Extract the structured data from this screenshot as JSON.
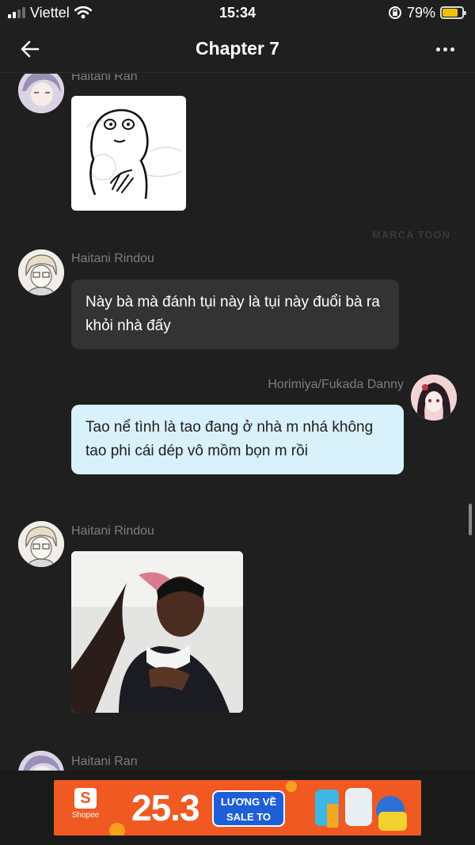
{
  "status": {
    "carrier": "Viettel",
    "time": "15:34",
    "battery_percent": "79%",
    "battery_level": 0.79
  },
  "header": {
    "title": "Chapter 7"
  },
  "messages": [
    {
      "sender": "Haitani Ran",
      "type": "image",
      "side": "left"
    },
    {
      "sender": "Haitani Rindou",
      "type": "text",
      "side": "left",
      "text": "Này bà mà đánh tụi này là tụi này đuổi bà ra khỏi nhà đấy"
    },
    {
      "sender": "Horimiya/Fukada Danny",
      "type": "text",
      "side": "right",
      "text": "Tao nể tình là tao đang ở nhà m nhá không tao phi cái dép vô mồm bọn m rồi"
    },
    {
      "sender": "Haitani Rindou",
      "type": "image",
      "side": "left"
    },
    {
      "sender": "Haitani Ran",
      "type": "image",
      "side": "left"
    }
  ],
  "watermark": "MARCA TOON",
  "ad": {
    "brand": "Shopee",
    "date": "25.3",
    "tag_line1": "LƯƠNG VỀ",
    "tag_line2": "SALE TO"
  },
  "colors": {
    "background": "#1f1f1f",
    "bubble_left": "#333333",
    "bubble_right": "#d9f1fb",
    "ad_orange": "#f05a22"
  }
}
